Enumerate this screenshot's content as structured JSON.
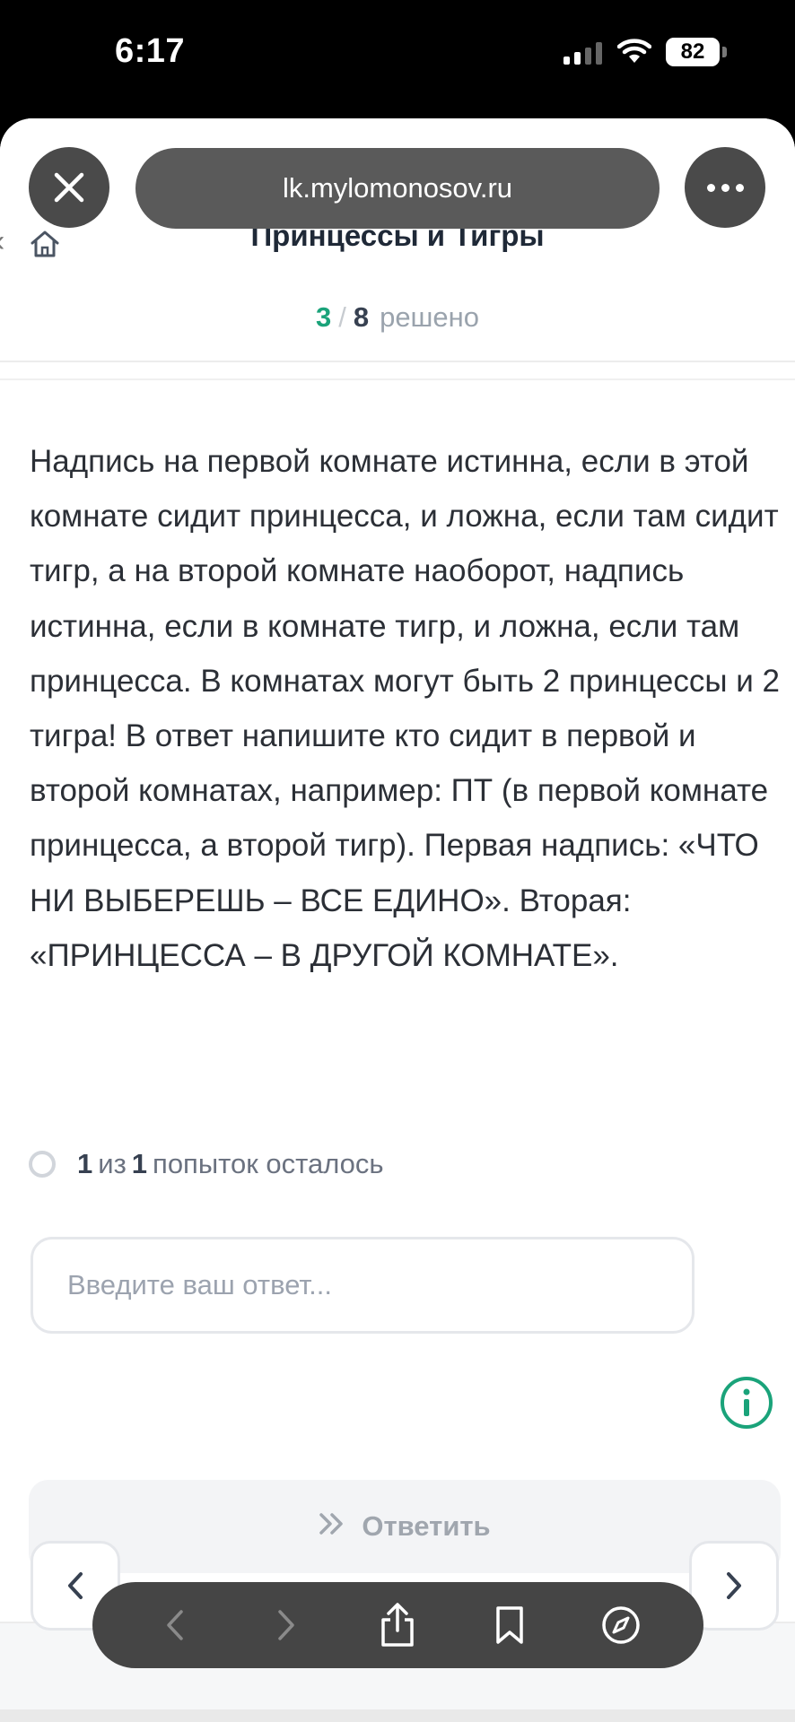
{
  "status_bar": {
    "time": "6:17",
    "battery": "82"
  },
  "browser": {
    "url": "lk.mylomonosov.ru"
  },
  "header": {
    "title": "Принцессы и Тигры",
    "progress": {
      "solved": "3",
      "separator": "/",
      "total": "8",
      "label": "решено"
    }
  },
  "task": {
    "question": "Надпись на первой комнате истинна, если в этой комнате сидит принцесса, и ложна, если там сидит тигр, а на второй комнате наоборот, надпись истинна, если в комнате тигр, и ложна, если там принцесса. В комнатах могут быть 2 принцессы и 2 тигра! В ответ напишите кто сидит в первой и второй комнатах, например: ПТ (в первой комнате принцесса, а второй тигр).  Первая надпись: «ЧТО НИ ВЫБЕРЕШЬ – ВСЕ ЕДИНО». Вторая: «ПРИНЦЕССА – В ДРУГОЙ КОМНАТЕ».",
    "attempts": {
      "left": "1",
      "of": "из",
      "total": "1",
      "label": "попыток осталось"
    },
    "answer_placeholder": "Введите ваш ответ...",
    "submit_label": "Ответить"
  },
  "colors": {
    "accent": "#1aa37a"
  },
  "icons": [
    "close-icon",
    "more-icon",
    "home-icon",
    "chevron-left-icon",
    "chevron-right-icon",
    "info-icon",
    "double-chevron-icon",
    "share-icon",
    "bookmark-icon",
    "compass-icon"
  ]
}
